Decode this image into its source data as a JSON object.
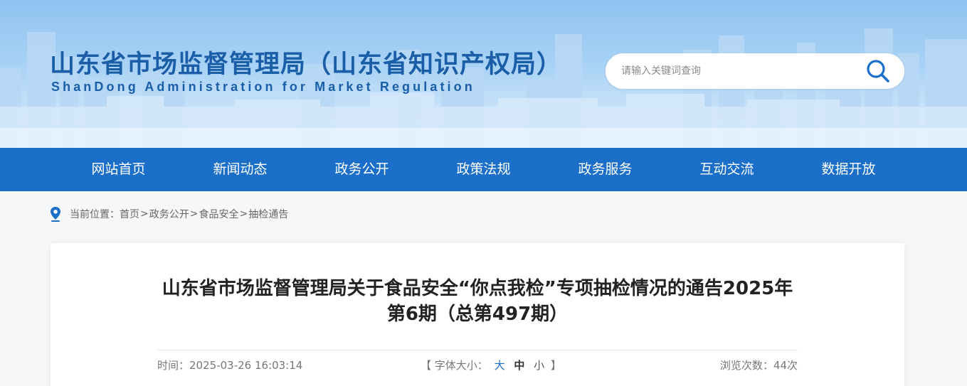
{
  "header": {
    "title": "山东省市场监督管理局（山东省知识产权局）",
    "subtitle": "ShanDong Administration for Market Regulation",
    "search_placeholder": "请输入关键词查询"
  },
  "nav": {
    "items": [
      "网站首页",
      "新闻动态",
      "政务公开",
      "政策法规",
      "政务服务",
      "互动交流",
      "数据开放"
    ]
  },
  "breadcrumb": {
    "prefix": "当前位置：",
    "items": [
      "首页",
      "政务公开",
      "食品安全",
      "抽检通告"
    ],
    "separator": ">"
  },
  "article": {
    "title": "山东省市场监督管理局关于食品安全“你点我检”专项抽检情况的通告2025年第6期（总第497期）",
    "time_label": "时间：",
    "time_value": "2025-03-26 16:03:14",
    "font_size_open": "【 字体大小：",
    "font_size_large": "大",
    "font_size_medium": "中",
    "font_size_small": "小",
    "font_size_close": "】",
    "views_label": "浏览次数：",
    "views_value": "44次"
  },
  "colors": {
    "brand_blue": "#1b6fc9",
    "title_blue": "#1a5ea8"
  }
}
